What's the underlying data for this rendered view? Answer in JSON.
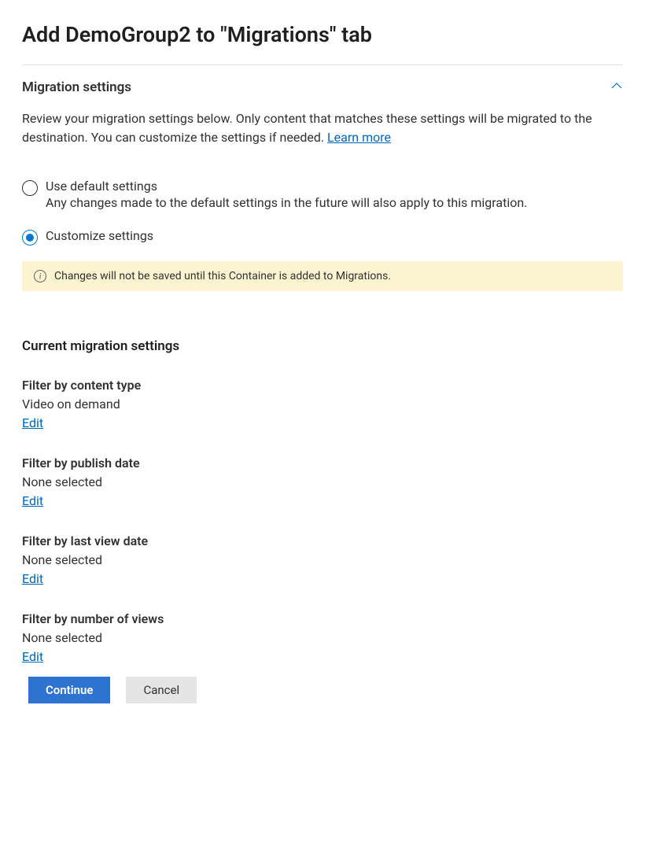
{
  "page_title": "Add DemoGroup2 to \"Migrations\" tab",
  "section": {
    "title": "Migration settings",
    "description_part1": "Review your migration settings below. Only content that matches these settings will be migrated to the destination. You can customize the settings if needed. ",
    "learn_more": "Learn more"
  },
  "radio": {
    "default": {
      "label": "Use default settings",
      "sublabel": "Any changes made to the default settings in the future will also apply to this migration."
    },
    "customize": {
      "label": "Customize settings"
    }
  },
  "info_banner": {
    "text": "Changes will not be saved until this Container is added to Migrations."
  },
  "current_settings": {
    "title": "Current migration settings",
    "filters": [
      {
        "title": "Filter by content type",
        "value": "Video on demand",
        "edit": "Edit"
      },
      {
        "title": "Filter by publish date",
        "value": "None selected",
        "edit": "Edit"
      },
      {
        "title": "Filter by last view date",
        "value": "None selected",
        "edit": "Edit"
      },
      {
        "title": "Filter by number of views",
        "value": "None selected",
        "edit": "Edit"
      }
    ]
  },
  "buttons": {
    "continue": "Continue",
    "cancel": "Cancel"
  }
}
